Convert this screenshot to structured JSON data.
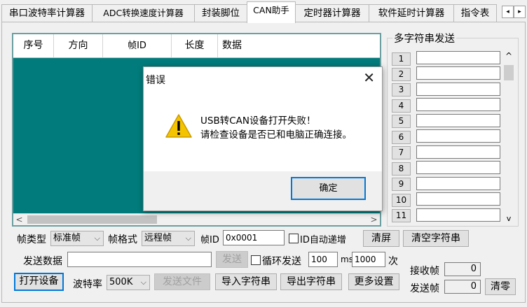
{
  "tabs": [
    "串口波特率计算器",
    "ADC转换速度计算器",
    "封装脚位",
    "CAN助手",
    "定时器计算器",
    "软件延时计算器",
    "指令表"
  ],
  "tab_scroll": {
    "left": "◂",
    "right": "▸"
  },
  "grid": {
    "columns": [
      "序号",
      "方向",
      "帧ID",
      "长度",
      "数据"
    ],
    "scroll_left": "<",
    "scroll_right": ">"
  },
  "multi_string": {
    "title": "多字符串发送",
    "numbers": [
      "1",
      "2",
      "3",
      "4",
      "5",
      "6",
      "7",
      "8",
      "9",
      "10",
      "11"
    ],
    "scroll_up": "^",
    "scroll_down": "v"
  },
  "controls": {
    "frame_type_label": "帧类型",
    "frame_type_value": "标准帧",
    "frame_format_label": "帧格式",
    "frame_format_value": "远程帧",
    "frame_id_label": "帧ID",
    "frame_id_value": "0x0001",
    "id_auto_inc_label": "ID自动递增",
    "clear_screen": "清屏",
    "clear_strings": "清空字符串",
    "send_data_label": "发送数据",
    "send_data_value": "",
    "send_button": "发送",
    "loop_send_label": "循环发送",
    "loop_interval": "100",
    "ms_label": "ms",
    "loop_count": "1000",
    "times_label": "次",
    "open_device": "打开设备",
    "baud_label": "波特率",
    "baud_value": "500K",
    "send_file": "发送文件",
    "import_strings": "导入字符串",
    "export_strings": "导出字符串",
    "more_settings": "更多设置",
    "rx_frames_label": "接收帧",
    "rx_frames_value": "0",
    "tx_frames_label": "发送帧",
    "tx_frames_value": "0",
    "clear_zero": "清零"
  },
  "dialog": {
    "title": "错误",
    "close": "✕",
    "line1": "USB转CAN设备打开失败！",
    "line2": "请检查设备是否已和电脑正确连接。",
    "ok": "确定"
  },
  "colors": {
    "grid_bg": "#017b7b",
    "focus": "#0078d7",
    "warning": "#f5c400"
  }
}
